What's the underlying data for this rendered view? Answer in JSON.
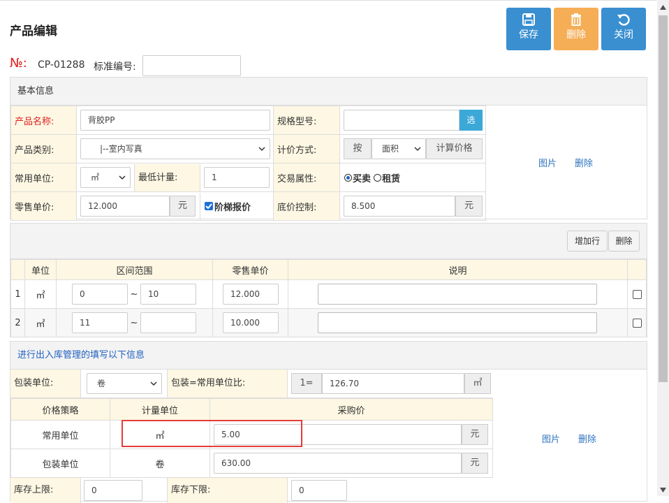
{
  "page": {
    "title": "产品编辑"
  },
  "toolbar": {
    "save_label": "保存",
    "delete_label": "删除",
    "close_label": "关闭"
  },
  "header": {
    "no_label": "№:",
    "no_value": "CP-01288",
    "std_label": "标准编号:",
    "std_value": ""
  },
  "basic": {
    "heading": "基本信息",
    "name_label": "产品名称:",
    "name_value": "背胶PP",
    "spec_label": "规格型号:",
    "spec_value": "",
    "spec_select_btn": "选",
    "category_label": "产品类别:",
    "category_value": "|--室内写真",
    "pricing_label": "计价方式:",
    "pricing_prefix": "按",
    "pricing_value": "面积",
    "pricing_calc_btn": "计算价格",
    "unit_label": "常用单位:",
    "unit_value": "㎡",
    "min_label": "最低计量:",
    "min_value": "1",
    "trade_label": "交易属性:",
    "trade_options": [
      "买卖",
      "租赁"
    ],
    "trade_selected": "买卖",
    "retail_label": "零售单价:",
    "retail_value": "12.000",
    "yuan": "元",
    "tier_label": "阶梯报价",
    "tier_checked": true,
    "floor_label": "底价控制:",
    "floor_value": "8.500",
    "picture_link": "图片",
    "delete_link": "删除"
  },
  "tier": {
    "add_row_btn": "增加行",
    "delete_btn": "删除",
    "headers": [
      "单位",
      "区间范围",
      "零售单价",
      "说明"
    ],
    "tilde": "~",
    "rows": [
      {
        "num": "1",
        "unit": "㎡",
        "from": "0",
        "to": "10",
        "price": "12.000",
        "note": ""
      },
      {
        "num": "2",
        "unit": "㎡",
        "from": "11",
        "to": "",
        "price": "10.000",
        "note": ""
      }
    ]
  },
  "stock": {
    "heading": "进行出入库管理的填写以下信息",
    "pack_label": "包装单位:",
    "pack_value": "卷",
    "ratio_label": "包装=常用单位比:",
    "ratio_prefix": "1=",
    "ratio_value": "126.70",
    "ratio_unit": "㎡",
    "headers": [
      "价格策略",
      "计量单位",
      "采购价"
    ],
    "rows": [
      {
        "strategy": "常用单位",
        "unit": "㎡",
        "price": "5.00"
      },
      {
        "strategy": "包装单位",
        "unit": "卷",
        "price": "630.00"
      }
    ],
    "yuan": "元",
    "upper_label": "库存上限:",
    "upper_value": "0",
    "lower_label": "库存下限:",
    "lower_value": "0",
    "picture_link": "图片",
    "delete_link": "删除"
  },
  "colors": {
    "primary": "#3a8fd0",
    "warning": "#f5ae56",
    "label_bg": "#fdf7e3",
    "highlight": "#e43c3c"
  }
}
